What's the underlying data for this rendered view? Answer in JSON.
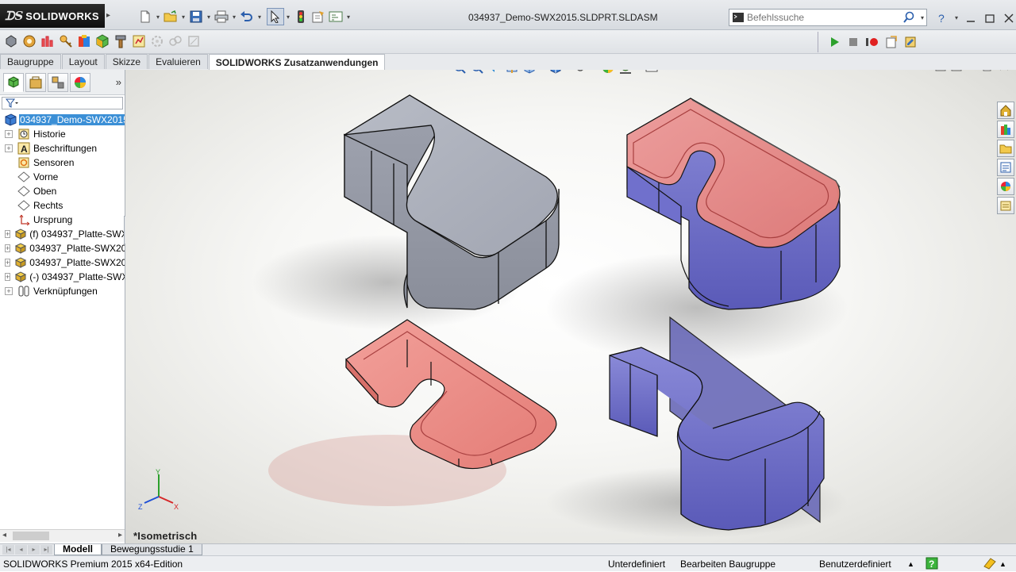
{
  "app": {
    "logo_text": "SOLIDWORKS",
    "document_title": "034937_Demo-SWX2015.SLDPRT.SLDASM"
  },
  "search": {
    "placeholder": "Befehlssuche"
  },
  "tabs": [
    {
      "label": "Baugruppe",
      "active": false
    },
    {
      "label": "Layout",
      "active": false
    },
    {
      "label": "Skizze",
      "active": false
    },
    {
      "label": "Evaluieren",
      "active": false
    },
    {
      "label": "SOLIDWORKS Zusatzanwendungen",
      "active": true
    }
  ],
  "tree": {
    "root": "034937_Demo-SWX2015.S",
    "items": [
      {
        "label": "Historie",
        "icon": "history-icon",
        "expandable": true
      },
      {
        "label": "Beschriftungen",
        "icon": "annotations-icon",
        "expandable": true
      },
      {
        "label": "Sensoren",
        "icon": "sensors-icon",
        "expandable": false
      },
      {
        "label": "Vorne",
        "icon": "plane-icon",
        "expandable": false
      },
      {
        "label": "Oben",
        "icon": "plane-icon",
        "expandable": false
      },
      {
        "label": "Rechts",
        "icon": "plane-icon",
        "expandable": false
      },
      {
        "label": "Ursprung",
        "icon": "origin-icon",
        "expandable": false
      },
      {
        "label": "(f) 034937_Platte-SWX",
        "icon": "part-icon",
        "expandable": true
      },
      {
        "label": "034937_Platte-SWX20",
        "icon": "part-icon",
        "expandable": true
      },
      {
        "label": "034937_Platte-SWX20",
        "icon": "part-icon",
        "expandable": true
      },
      {
        "label": "(-) 034937_Platte-SWX",
        "icon": "part-icon",
        "expandable": true
      },
      {
        "label": "Verknüpfungen",
        "icon": "mates-icon",
        "expandable": true
      }
    ]
  },
  "viewport": {
    "view_label": "*Isometrisch"
  },
  "triad": {
    "x": "X",
    "y": "Y",
    "z": "Z"
  },
  "bottom_tabs": [
    {
      "label": "Modell",
      "active": true
    },
    {
      "label": "Bewegungsstudie 1",
      "active": false
    }
  ],
  "status": {
    "edition": "SOLIDWORKS Premium 2015 x64-Edition",
    "state": "Unterdefiniert",
    "editing": "Bearbeiten Baugruppe",
    "units": "Benutzerdefiniert"
  },
  "colors": {
    "gray_part": "#a9adb8",
    "red_part": "#e98a85",
    "blue_part": "#7474c8",
    "selection": "#3b8fd6"
  }
}
